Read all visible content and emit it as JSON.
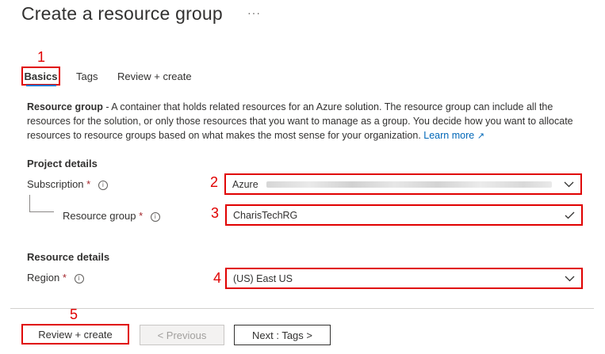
{
  "header": {
    "title": "Create a resource group",
    "more_label": "···"
  },
  "callouts": [
    "1",
    "2",
    "3",
    "4",
    "5"
  ],
  "tabs": [
    {
      "label": "Basics"
    },
    {
      "label": "Tags"
    },
    {
      "label": "Review + create"
    }
  ],
  "description": {
    "lead": "Resource group",
    "body": " - A container that holds related resources for an Azure solution. The resource group can include all the resources for the solution, or only those resources that you want to manage as a group. You decide how you want to allocate resources to resource groups based on what makes the most sense for your organization. ",
    "link": "Learn more"
  },
  "project_details": {
    "heading": "Project details",
    "subscription_label": "Subscription",
    "subscription_value": "Azure",
    "resource_group_label": "Resource group",
    "resource_group_value": "CharisTechRG"
  },
  "resource_details": {
    "heading": "Resource details",
    "region_label": "Region",
    "region_value": "(US) East US"
  },
  "required_mark": "*",
  "footer": {
    "review_create": "Review + create",
    "previous": "< Previous",
    "next": "Next : Tags >"
  },
  "colors": {
    "annotation_red": "#e00000",
    "link_blue": "#0067b8",
    "tab_underline": "#0078d4"
  }
}
